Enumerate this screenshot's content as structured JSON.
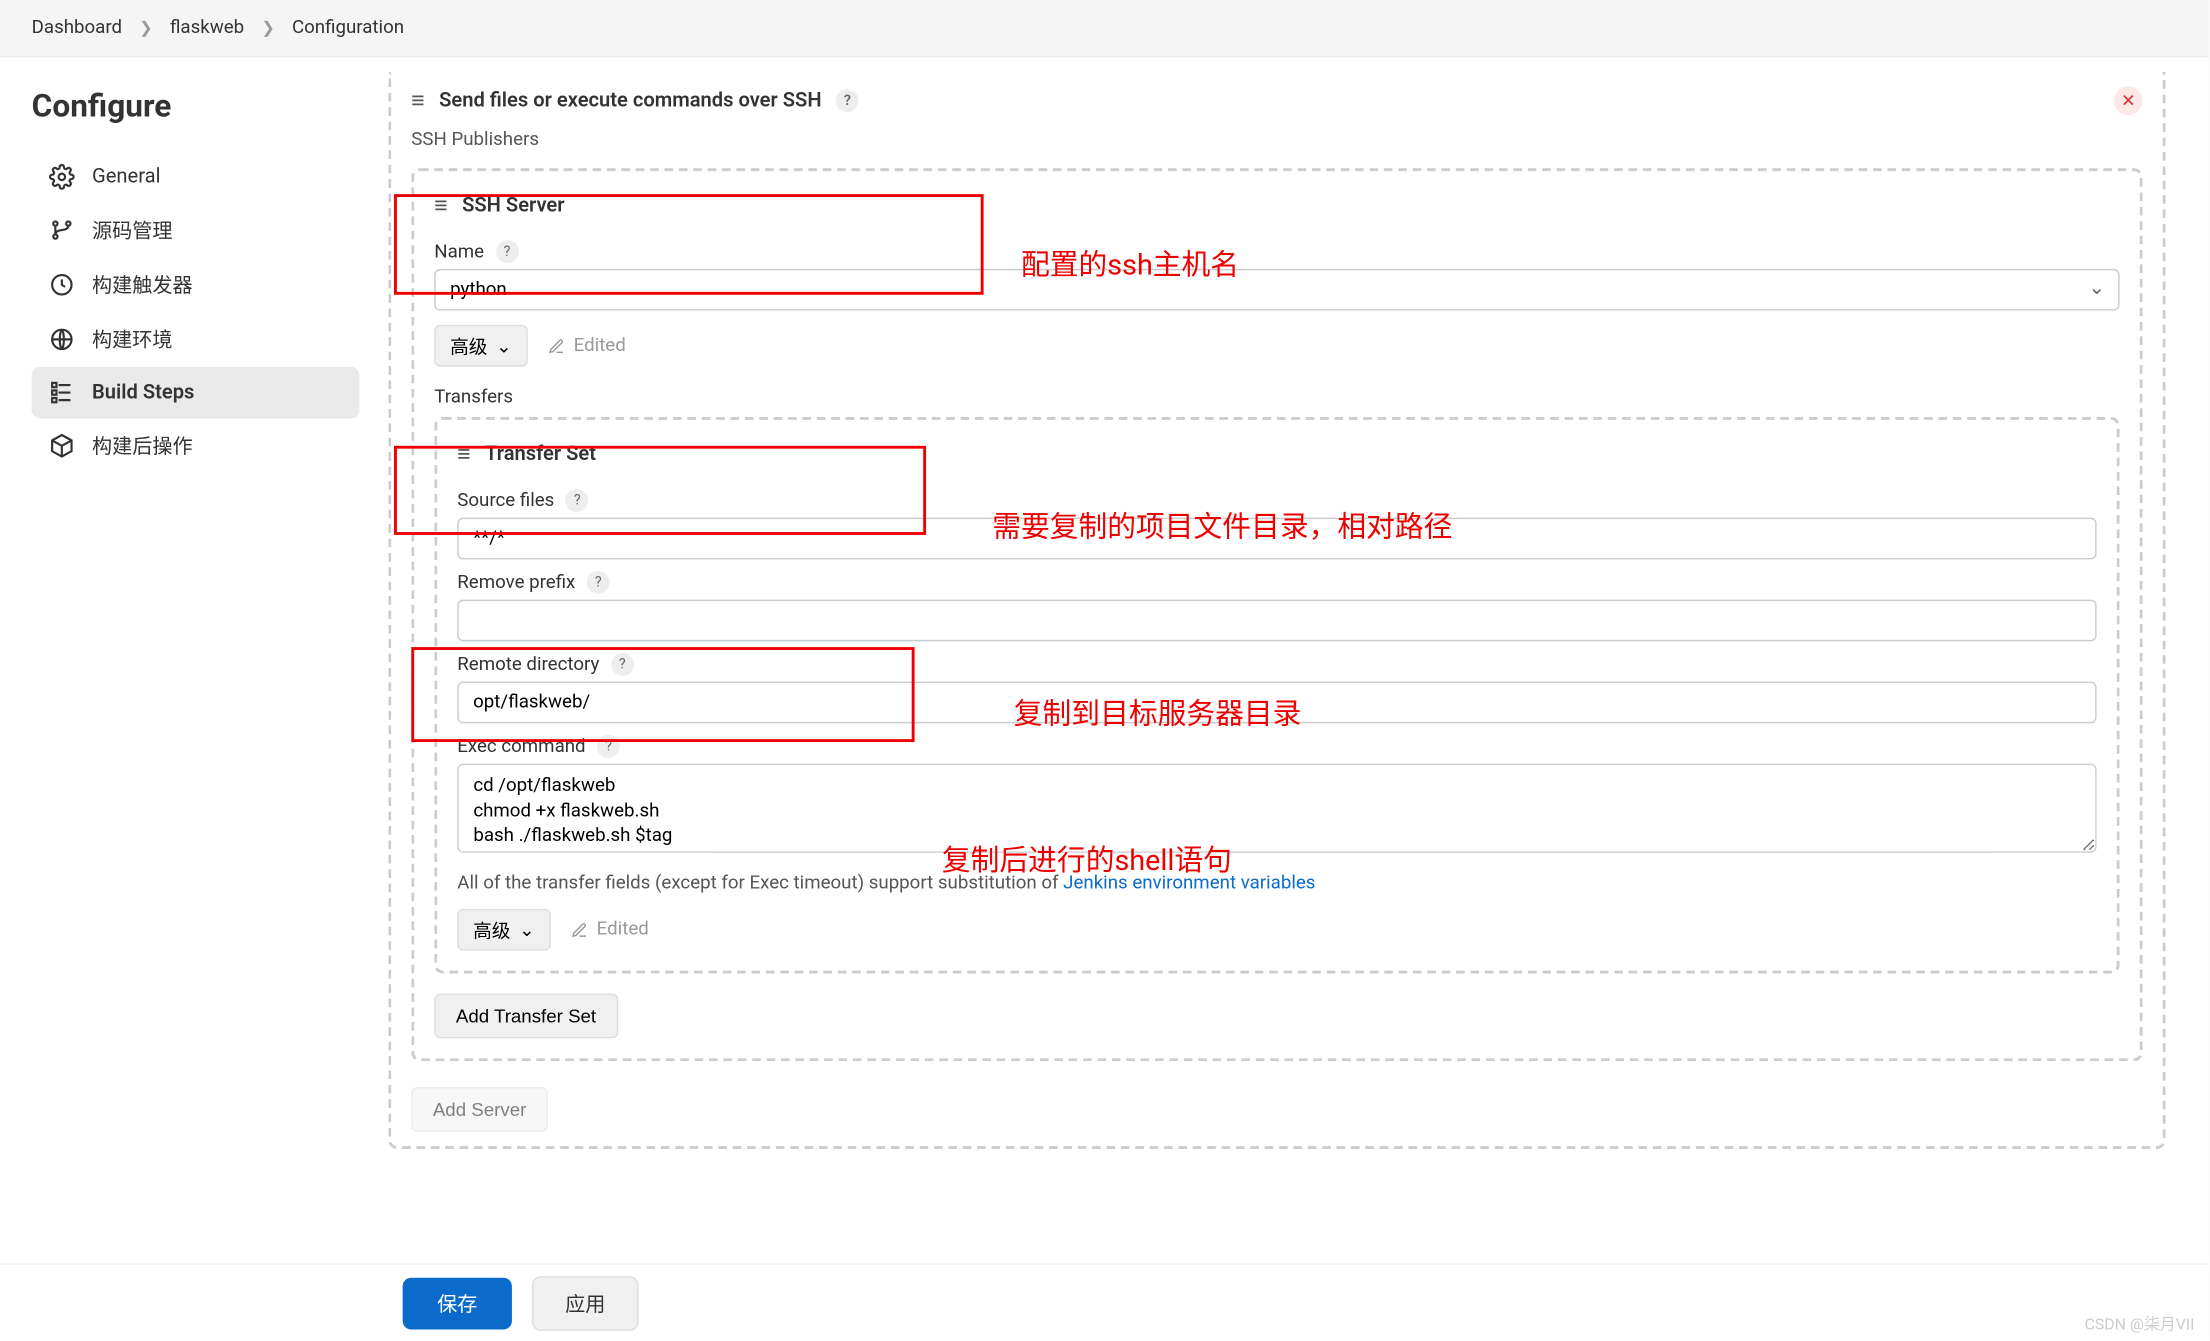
{
  "breadcrumb": {
    "dashboard": "Dashboard",
    "project": "flaskweb",
    "page": "Configuration"
  },
  "sidebar": {
    "title": "Configure",
    "items": [
      {
        "label": "General"
      },
      {
        "label": "源码管理"
      },
      {
        "label": "构建触发器"
      },
      {
        "label": "构建环境"
      },
      {
        "label": "Build Steps"
      },
      {
        "label": "构建后操作"
      }
    ]
  },
  "step": {
    "title": "Send files or execute commands over SSH",
    "publishers_label": "SSH Publishers",
    "server_title": "SSH Server",
    "name_label": "Name",
    "name_value": "python",
    "adv_label": "高级",
    "edited_label": "Edited",
    "transfers_label": "Transfers",
    "transfer_set_title": "Transfer Set",
    "source_files_label": "Source files",
    "source_files_value": "**/*",
    "remove_prefix_label": "Remove prefix",
    "remove_prefix_value": "",
    "remote_dir_label": "Remote directory",
    "remote_dir_value": "opt/flaskweb/",
    "exec_cmd_label": "Exec command",
    "exec_cmd_value": "cd /opt/flaskweb\nchmod +x flaskweb.sh\nbash ./flaskweb.sh $tag",
    "info_prefix": "All of the transfer fields (except for Exec timeout) support substitution of ",
    "info_link": "Jenkins environment variables",
    "add_transfer": "Add Transfer Set",
    "add_server": "Add Server"
  },
  "bottom": {
    "save": "保存",
    "apply": "应用"
  },
  "watermark": "CSDN @柒月VII",
  "annotations": {
    "a1": "配置的ssh主机名",
    "a2": "需要复制的项目文件目录，相对路径",
    "a3": "复制到目标服务器目录",
    "a4": "复制后进行的shell语句"
  }
}
